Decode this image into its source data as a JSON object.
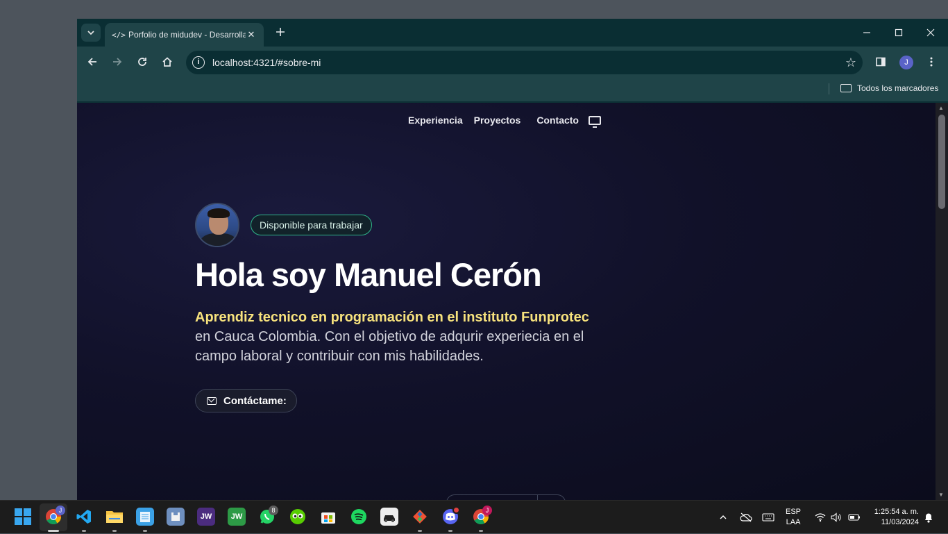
{
  "browser": {
    "tab_icon": "</>",
    "tab_title": "Porfolio de midudev - Desarrollador",
    "url": "localhost:4321/#sobre-mi",
    "profile_initial": "J",
    "bookmarks_label": "Todos los marcadores"
  },
  "site": {
    "nav": [
      "Experiencia",
      "Proyectos",
      "Contacto"
    ],
    "badge": "Disponible para trabajar",
    "title": "Hola soy Manuel Cerón",
    "desc_highlight": "Aprendiz tecnico en programación en el instituto Funprotec",
    "desc_rest": " en Cauca Colombia. Con el objetivo de adqurir experiecia en el campo laboral y contribuir con mis habilidades.",
    "cta": "Contáctame:"
  },
  "taskbar": {
    "whatsapp_badge": "8",
    "jw1_label": "JW",
    "jw2_label": "JW",
    "chrome_profile": "J",
    "chrome2_profile": "J",
    "lang_line1": "ESP",
    "lang_line2": "LAA",
    "time": "1:25:54 a. m.",
    "date": "11/03/2024"
  },
  "colors": {
    "accent_highlight": "#f7e27d",
    "badge_border": "#2fb58a",
    "browser_frame": "#1f4448"
  },
  "icons": [
    "code-icon",
    "close-icon",
    "plus-icon",
    "back-icon",
    "forward-icon",
    "reload-icon",
    "home-icon",
    "info-icon",
    "star-icon",
    "sidepanel-icon",
    "more-icon",
    "folder-icon",
    "monitor-icon",
    "mail-icon"
  ]
}
